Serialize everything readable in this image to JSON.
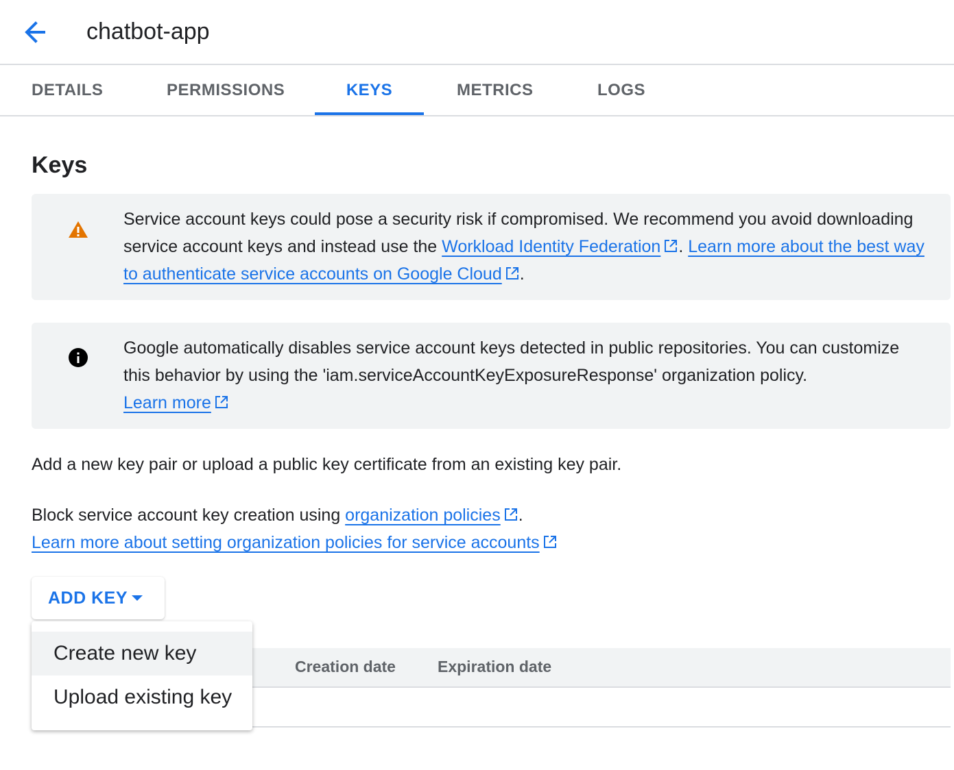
{
  "header": {
    "back_icon": "arrow-back-icon",
    "title": "chatbot-app"
  },
  "tabs": [
    {
      "label": "DETAILS",
      "active": false
    },
    {
      "label": "PERMISSIONS",
      "active": false
    },
    {
      "label": "KEYS",
      "active": true
    },
    {
      "label": "METRICS",
      "active": false
    },
    {
      "label": "LOGS",
      "active": false
    }
  ],
  "colors": {
    "accent": "#1a73e8",
    "warning": "#e37400",
    "banner_bg": "#f1f3f4"
  },
  "keys_section": {
    "heading": "Keys",
    "warning_banner": {
      "icon": "warning-icon",
      "text_1": "Service account keys could pose a security risk if compromised. We recommend you avoid downloading service account keys and instead use the ",
      "link_1": "Workload Identity Federation",
      "text_2": ". ",
      "link_2": "Learn more about the best way to authenticate service accounts on Google Cloud",
      "text_3": "."
    },
    "info_banner": {
      "icon": "info-icon",
      "text": "Google automatically disables service account keys detected in public repositories. You can customize this behavior by using the 'iam.serviceAccountKeyExposureResponse' organization policy.",
      "link": "Learn more"
    },
    "add_key_description": "Add a new key pair or upload a public key certificate from an existing key pair.",
    "block_text": "Block service account key creation using ",
    "block_link": "organization policies",
    "block_end": ".",
    "learn_more_policies": "Learn more about setting organization policies for service accounts",
    "add_key_button": "ADD KEY",
    "dropdown": {
      "items": [
        "Create new key",
        "Upload existing key"
      ],
      "hovered_index": 0
    },
    "table": {
      "columns": [
        "Creation date",
        "Expiration date"
      ]
    }
  }
}
